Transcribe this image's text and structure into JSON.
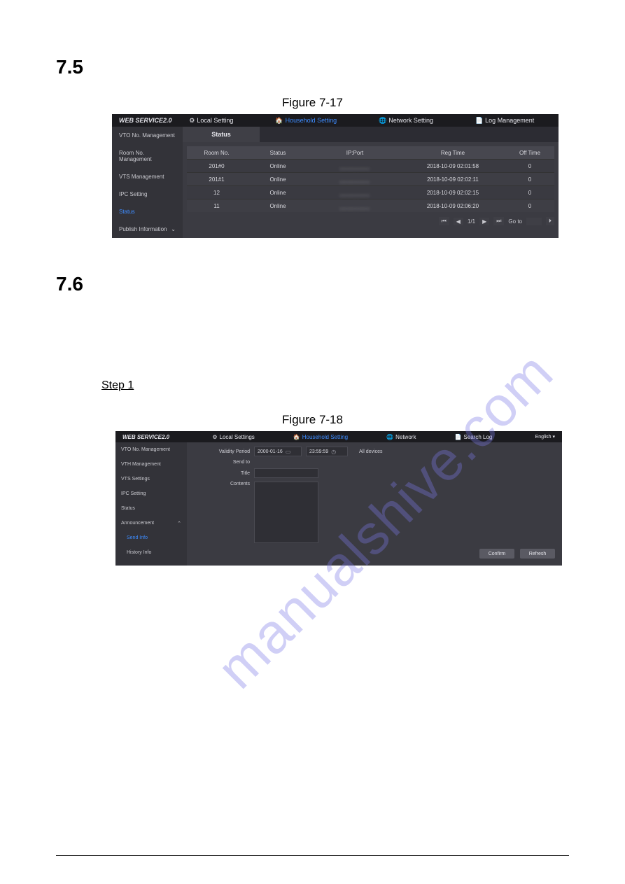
{
  "doc": {
    "sec1": "7.5",
    "sec2": "7.6",
    "fig1_label": "Figure 7-17",
    "fig2_label": "Figure 7-18",
    "step1": "Step 1"
  },
  "app17": {
    "brand": "WEB SERVICE2.0",
    "tabs": {
      "local": "Local Setting",
      "household": "Household Setting",
      "network": "Network Setting",
      "log": "Log Management"
    },
    "sidebar": {
      "items": [
        {
          "label": "VTO No. Management"
        },
        {
          "label": "Room No. Management"
        },
        {
          "label": "VTS Management"
        },
        {
          "label": "IPC Setting"
        },
        {
          "label": "Status"
        },
        {
          "label": "Publish Information"
        }
      ]
    },
    "subtab": "Status",
    "table": {
      "headers": {
        "room": "Room No.",
        "status": "Status",
        "ip": "IP:Port",
        "reg": "Reg Time",
        "off": "Off Time"
      },
      "rows": [
        {
          "room": "201#0",
          "status": "Online",
          "ip": "________",
          "reg": "2018-10-09 02:01:58",
          "off": "0"
        },
        {
          "room": "201#1",
          "status": "Online",
          "ip": "________",
          "reg": "2018-10-09 02:02:11",
          "off": "0"
        },
        {
          "room": "12",
          "status": "Online",
          "ip": "________",
          "reg": "2018-10-09 02:02:15",
          "off": "0"
        },
        {
          "room": "11",
          "status": "Online",
          "ip": "________",
          "reg": "2018-10-09 02:06:20",
          "off": "0"
        }
      ]
    },
    "pager": {
      "page": "1/1",
      "goto": "Go to",
      "first": "⏮",
      "prev": "◀",
      "next": "▶",
      "last": "⏭"
    }
  },
  "app18": {
    "brand": "WEB SERVICE2.0",
    "tabs": {
      "local": "Local Settings",
      "household": "Household Setting",
      "network": "Network",
      "log": "Search Log"
    },
    "lang": "English",
    "sidebar": {
      "items": [
        {
          "label": "VTO No. Management"
        },
        {
          "label": "VTH Management"
        },
        {
          "label": "VTS Settings"
        },
        {
          "label": "IPC Setting"
        },
        {
          "label": "Status"
        },
        {
          "label": "Announcement"
        },
        {
          "label": "Send Info"
        },
        {
          "label": "History Info"
        }
      ]
    },
    "form": {
      "validity_label": "Validity Period",
      "validity_date": "2000-01-16",
      "validity_time": "23:59:59",
      "sendto_label": "Send to",
      "sendto_value": "All devices",
      "title_label": "Title",
      "contents_label": "Contents"
    },
    "buttons": {
      "confirm": "Confirm",
      "refresh": "Refresh"
    }
  }
}
